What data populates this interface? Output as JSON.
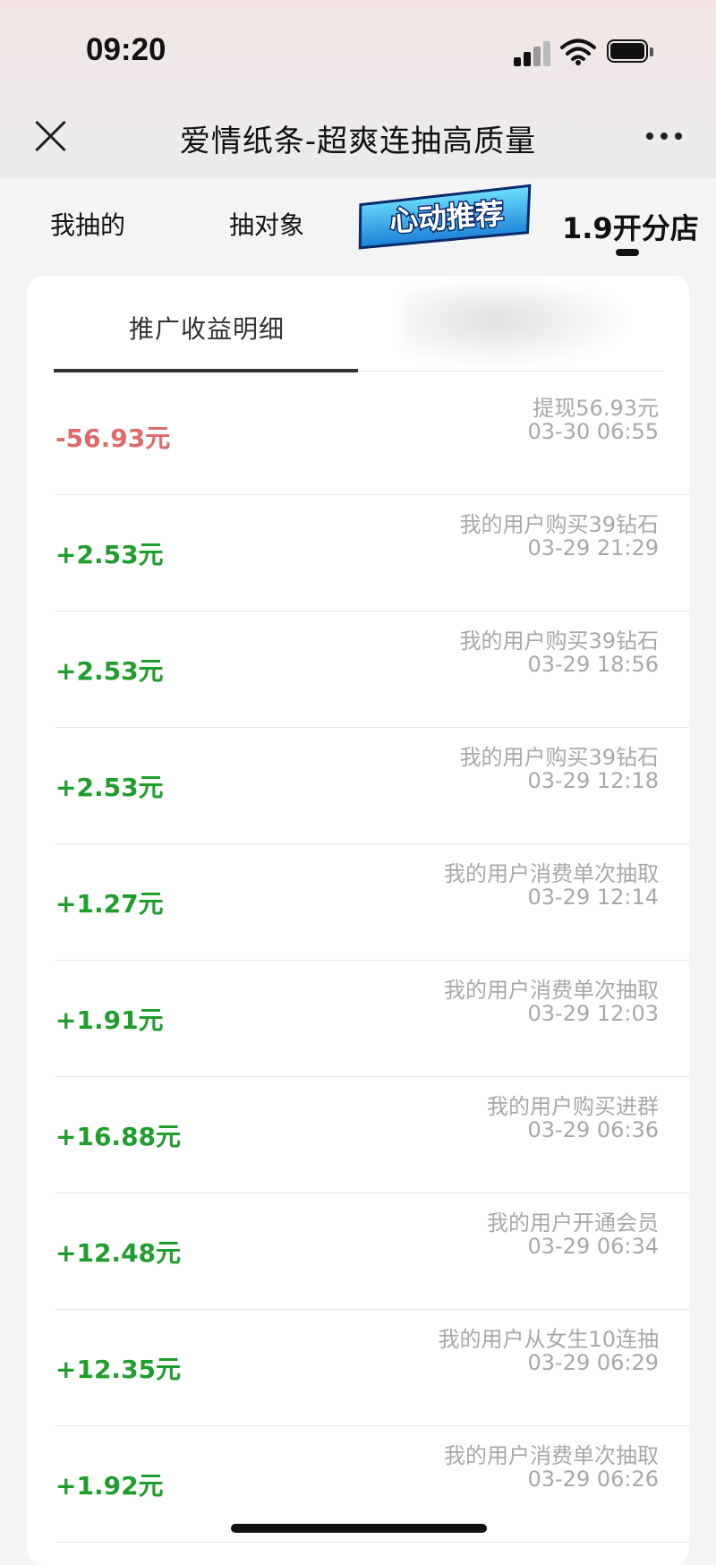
{
  "status_bar": {
    "time": "09:20"
  },
  "header": {
    "title": "爱情纸条-超爽连抽高质量"
  },
  "tabs": [
    {
      "label": "我抽的"
    },
    {
      "label": "抽对象"
    },
    {
      "label": "心动推荐"
    },
    {
      "label": "1.9开分店"
    }
  ],
  "subtab": {
    "label": "推广收益明细"
  },
  "records": [
    {
      "amount": "-56.93元",
      "desc": "提现56.93元",
      "time": "03-30 06:55"
    },
    {
      "amount": "+2.53元",
      "desc": "我的用户购买39钻石",
      "time": "03-29 21:29"
    },
    {
      "amount": "+2.53元",
      "desc": "我的用户购买39钻石",
      "time": "03-29 18:56"
    },
    {
      "amount": "+2.53元",
      "desc": "我的用户购买39钻石",
      "time": "03-29 12:18"
    },
    {
      "amount": "+1.27元",
      "desc": "我的用户消费单次抽取",
      "time": "03-29 12:14"
    },
    {
      "amount": "+1.91元",
      "desc": "我的用户消费单次抽取",
      "time": "03-29 12:03"
    },
    {
      "amount": "+16.88元",
      "desc": "我的用户购买进群",
      "time": "03-29 06:36"
    },
    {
      "amount": "+12.48元",
      "desc": "我的用户开通会员",
      "time": "03-29 06:34"
    },
    {
      "amount": "+12.35元",
      "desc": "我的用户从女生10连抽",
      "time": "03-29 06:29"
    },
    {
      "amount": "+1.92元",
      "desc": "我的用户消费单次抽取",
      "time": "03-29 06:26"
    }
  ],
  "colors": {
    "negative": "#e0696a",
    "positive": "#1f9e2e",
    "muted": "#a8a8a8"
  },
  "icons": [
    "signal-icon",
    "wifi-icon",
    "battery-icon",
    "close-icon",
    "more-icon"
  ]
}
